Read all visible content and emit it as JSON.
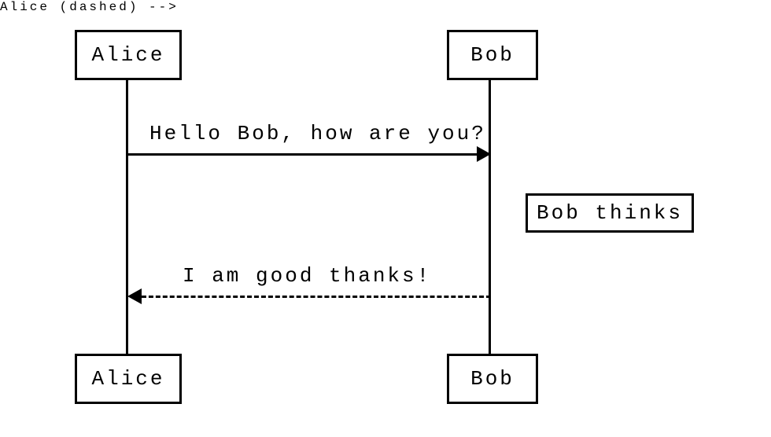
{
  "participants": {
    "alice": "Alice",
    "bob": "Bob"
  },
  "messages": {
    "m1": "Hello Bob, how are you?",
    "m2": "I am good thanks!"
  },
  "notes": {
    "bob_thinks": "Bob thinks"
  },
  "chart_data": {
    "type": "sequence-diagram",
    "participants": [
      "Alice",
      "Bob"
    ],
    "events": [
      {
        "type": "message",
        "from": "Alice",
        "to": "Bob",
        "text": "Hello Bob, how are you?",
        "style": "solid"
      },
      {
        "type": "note",
        "over": "Bob",
        "position": "right",
        "text": "Bob thinks"
      },
      {
        "type": "message",
        "from": "Bob",
        "to": "Alice",
        "text": "I am good thanks!",
        "style": "dashed"
      }
    ]
  }
}
